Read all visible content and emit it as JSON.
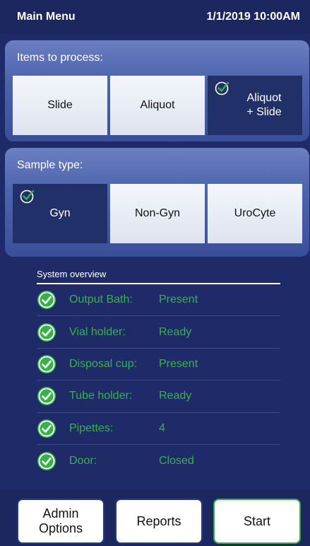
{
  "header": {
    "title": "Main Menu",
    "datetime": "1/1/2019 10:00AM"
  },
  "items_panel": {
    "title": "Items to process:",
    "options": [
      {
        "label": "Slide",
        "selected": false
      },
      {
        "label": "Aliquot",
        "selected": false
      },
      {
        "label_line1": "Aliquot",
        "label_line2": "+ Slide",
        "selected": true
      }
    ]
  },
  "sample_panel": {
    "title": "Sample type:",
    "options": [
      {
        "label": "Gyn",
        "selected": true
      },
      {
        "label": "Non-Gyn",
        "selected": false
      },
      {
        "label": "UroCyte",
        "selected": false
      }
    ]
  },
  "overview": {
    "title": "System overview",
    "rows": [
      {
        "label": "Output Bath:",
        "value": "Present",
        "icon": "check-circle-icon"
      },
      {
        "label": "Vial holder:",
        "value": "Ready",
        "icon": "check-circle-icon"
      },
      {
        "label": "Disposal cup:",
        "value": "Present",
        "icon": "check-circle-icon"
      },
      {
        "label": "Tube holder:",
        "value": "Ready",
        "icon": "check-circle-icon"
      },
      {
        "label": "Pipettes:",
        "value": "4",
        "icon": "check-circle-icon"
      },
      {
        "label": "Door:",
        "value": "Closed",
        "icon": "check-circle-icon"
      }
    ]
  },
  "actions": {
    "admin_line1": "Admin",
    "admin_line2": "Options",
    "reports": "Reports",
    "start": "Start"
  },
  "colors": {
    "background": "#1f2b68",
    "selected": "#22306a",
    "status_green": "#37b24a",
    "start_border": "#2eae45"
  }
}
